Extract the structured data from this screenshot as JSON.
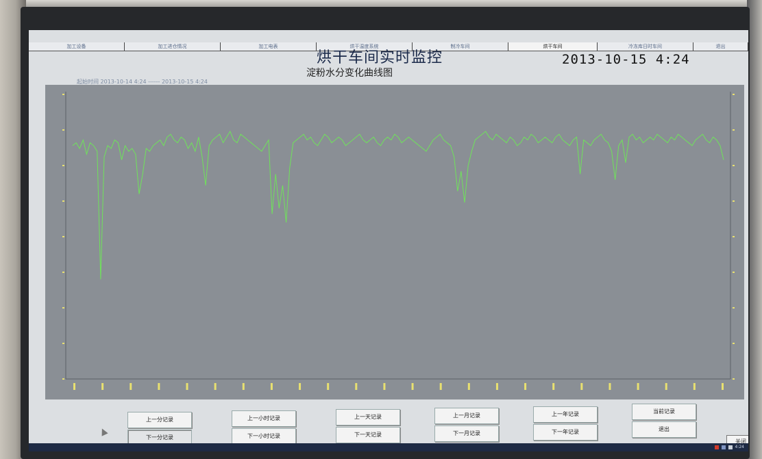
{
  "app": {
    "title": "烘干车间实时监控",
    "datetime": "2013-10-15  4:24",
    "chart_title": "淀粉水分变化曲线图",
    "range_text": "起始时间 2013-10-14 4:24 ------ 2013-10-15 4:24"
  },
  "tabs": [
    {
      "label": "加工设备",
      "active": false
    },
    {
      "label": "加工进仓情况",
      "active": false
    },
    {
      "label": "加工电表",
      "active": false
    },
    {
      "label": "烘干温度系统",
      "active": false
    },
    {
      "label": "制冷车间",
      "active": false
    },
    {
      "label": "烘干车间",
      "active": true
    },
    {
      "label": "冷冻库日时车间",
      "active": false
    },
    {
      "label": "退出",
      "active": false
    }
  ],
  "colors": {
    "line": "#6fe35a",
    "axis": "#e8e070",
    "plot_bg": "#8a8f95"
  },
  "chart_data": {
    "type": "line",
    "title": "淀粉水分变化曲线图",
    "xlabel": "",
    "ylabel": "",
    "ylim": [
      0,
      100
    ],
    "grid": false,
    "series": [
      {
        "values": [
          82,
          83,
          81,
          84,
          79,
          83,
          82,
          80,
          35,
          78,
          82,
          81,
          84,
          83,
          77,
          82,
          80,
          81,
          79,
          65,
          72,
          81,
          80,
          82,
          83,
          84,
          82,
          85,
          86,
          84,
          83,
          85,
          84,
          81,
          83,
          80,
          85,
          78,
          68,
          82,
          84,
          85,
          86,
          83,
          85,
          87,
          84,
          83,
          86,
          85,
          84,
          83,
          82,
          81,
          80,
          82,
          84,
          58,
          72,
          60,
          68,
          55,
          74,
          83,
          84,
          85,
          86,
          84,
          85,
          83,
          82,
          84,
          86,
          85,
          83,
          84,
          85,
          84,
          82,
          83,
          84,
          85,
          86,
          84,
          83,
          84,
          85,
          83,
          82,
          84,
          85,
          84,
          86,
          85,
          83,
          84,
          85,
          84,
          83,
          82,
          81,
          80,
          82,
          84,
          85,
          86,
          84,
          83,
          82,
          78,
          66,
          73,
          62,
          75,
          80,
          84,
          85,
          86,
          87,
          85,
          84,
          86,
          85,
          84,
          83,
          85,
          84,
          82,
          83,
          85,
          84,
          86,
          85,
          83,
          84,
          85,
          84,
          83,
          85,
          86,
          84,
          83,
          82,
          84,
          85,
          72,
          84,
          83,
          82,
          84,
          85,
          86,
          84,
          83,
          80,
          70,
          82,
          84,
          76,
          85,
          86,
          84,
          85,
          83,
          84,
          85,
          84,
          86,
          85,
          84,
          83,
          85,
          84,
          86,
          85,
          84,
          83,
          82,
          84,
          85,
          86,
          84,
          83,
          85,
          84,
          82,
          77
        ]
      }
    ]
  },
  "close_label": "关闭",
  "nav": [
    {
      "label": "上一分记录",
      "pressed": false
    },
    {
      "label": "下一分记录",
      "pressed": true
    },
    {
      "label": "上一小时记录",
      "pressed": false
    },
    {
      "label": "下一小时记录",
      "pressed": false
    },
    {
      "label": "上一天记录",
      "pressed": false
    },
    {
      "label": "下一天记录",
      "pressed": false
    },
    {
      "label": "上一月记录",
      "pressed": false
    },
    {
      "label": "下一月记录",
      "pressed": false
    },
    {
      "label": "上一年记录",
      "pressed": false
    },
    {
      "label": "下一年记录",
      "pressed": false
    },
    {
      "label": "当前记录",
      "pressed": false
    },
    {
      "label": "退出",
      "pressed": false
    }
  ],
  "taskbar": {
    "time": "4:24"
  }
}
